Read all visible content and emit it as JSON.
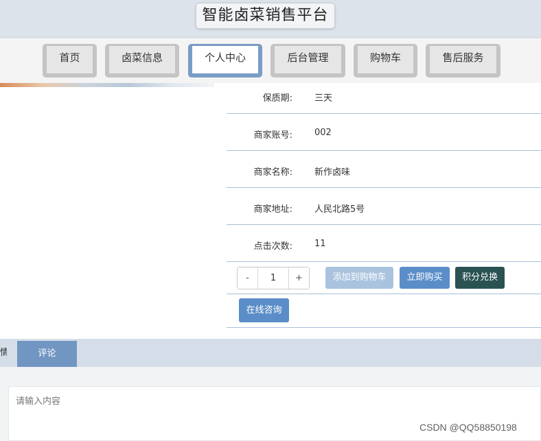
{
  "header": {
    "title": "智能卤菜销售平台"
  },
  "nav": {
    "items": [
      {
        "label": "首页",
        "active": false
      },
      {
        "label": "卤菜信息",
        "active": false
      },
      {
        "label": "个人中心",
        "active": true
      },
      {
        "label": "后台管理",
        "active": false
      },
      {
        "label": "购物车",
        "active": false
      },
      {
        "label": "售后服务",
        "active": false
      }
    ]
  },
  "details": [
    {
      "label": "保质期:",
      "value": "三天"
    },
    {
      "label": "商家账号:",
      "value": "002"
    },
    {
      "label": "商家名称:",
      "value": "新作卤味"
    },
    {
      "label": "商家地址:",
      "value": "人民北路5号"
    },
    {
      "label": "点击次数:",
      "value": "11"
    }
  ],
  "stepper": {
    "minus": "-",
    "value": "1",
    "plus": "+"
  },
  "actions": {
    "add_to_cart": "添加到购物车",
    "buy_now": "立即购买",
    "points_redeem": "积分兑换",
    "consult": "在线咨询"
  },
  "tabs": {
    "partial_label": "情",
    "comment": "评论"
  },
  "comment": {
    "placeholder": "请输入内容"
  },
  "watermark": "CSDN @QQ58850198",
  "colors": {
    "primary": "#5b8ec8",
    "primary_light": "#a9c3df",
    "dark_teal": "#2a5252",
    "tab_active": "#7296c2",
    "nav_active_border": "#7a9cc6"
  }
}
